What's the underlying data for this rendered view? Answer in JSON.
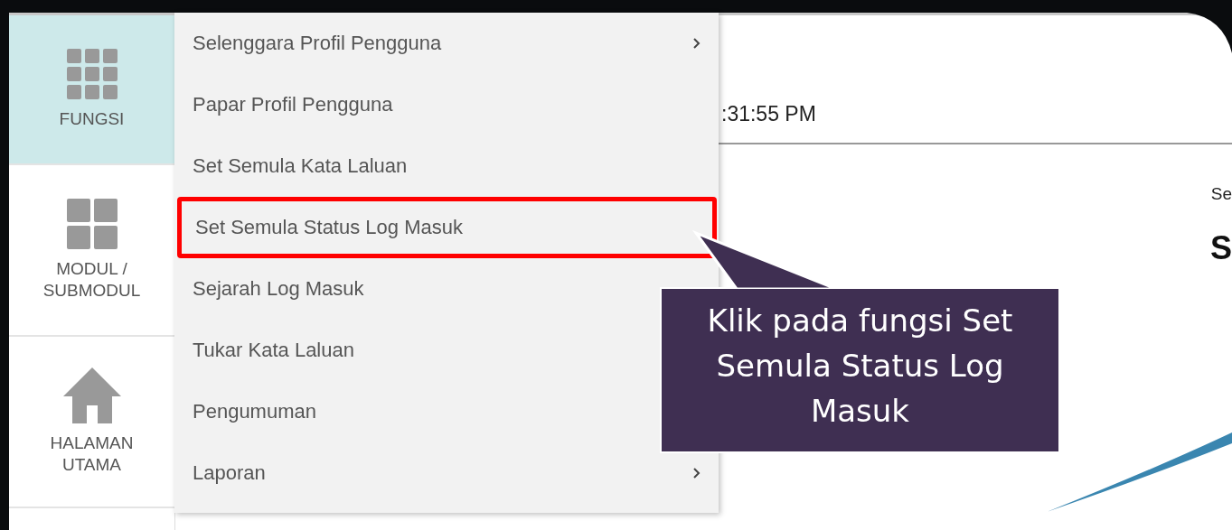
{
  "sidebar": {
    "items": [
      {
        "label": "FUNGSI",
        "kind": "functions",
        "selected": true
      },
      {
        "label": "MODUL / SUBMODUL",
        "kind": "modules",
        "selected": false
      },
      {
        "label": "HALAMAN UTAMA",
        "kind": "home",
        "selected": false
      }
    ]
  },
  "menu": {
    "items": [
      {
        "label": "Selenggara Profil Pengguna",
        "submenu": true,
        "highlighted": false
      },
      {
        "label": "Papar Profil Pengguna",
        "submenu": false,
        "highlighted": false
      },
      {
        "label": "Set Semula Kata Laluan",
        "submenu": false,
        "highlighted": false
      },
      {
        "label": "Set Semula Status Log Masuk",
        "submenu": false,
        "highlighted": true
      },
      {
        "label": "Sejarah Log Masuk",
        "highlighted": false
      },
      {
        "label": "Tukar Kata Laluan",
        "highlighted": false
      },
      {
        "label": "Pengumuman",
        "highlighted": false
      },
      {
        "label": "Laporan",
        "submenu": true,
        "highlighted": false
      }
    ]
  },
  "header": {
    "time": ":31:55 PM"
  },
  "content": {
    "text_1": "Se",
    "heading": "S"
  },
  "callout": {
    "text": "Klik pada fungsi Set Semula Status Log Masuk"
  }
}
